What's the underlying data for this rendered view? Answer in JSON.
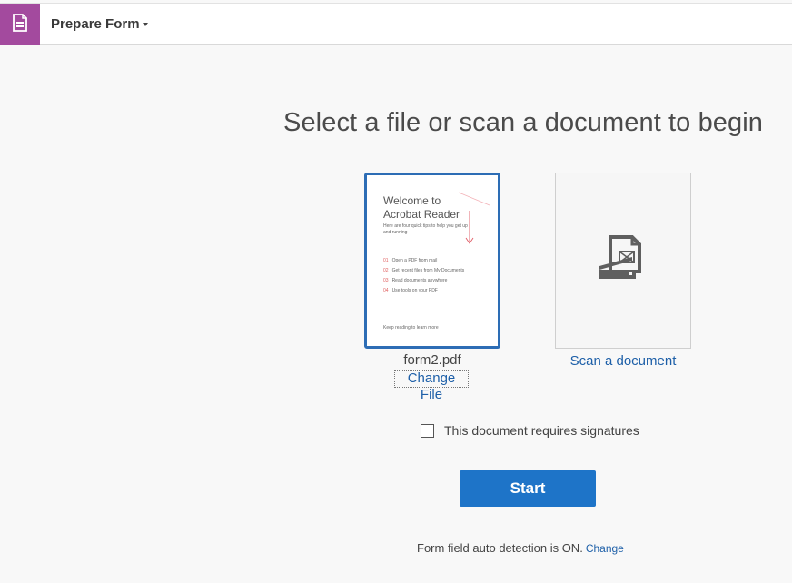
{
  "header": {
    "tool_icon": "form-document-icon",
    "tool_title": "Prepare Form"
  },
  "main": {
    "title": "Select a file or scan a document to begin"
  },
  "file_card": {
    "thumbnail": {
      "title_line1": "Welcome to",
      "title_line2": "Acrobat Reader",
      "subtitle": "Here are four quick tips to help you get up and running",
      "tips": [
        {
          "num": "01",
          "text": "Open a PDF from mail"
        },
        {
          "num": "02",
          "text": "Get recent files from My Documents"
        },
        {
          "num": "03",
          "text": "Read documents anywhere"
        },
        {
          "num": "04",
          "text": "Use tools on your PDF"
        }
      ],
      "footer": "Keep reading to learn more"
    },
    "file_name": "form2.pdf",
    "change_label": "Change File"
  },
  "scan_card": {
    "icon": "scanner-icon",
    "label": "Scan a document"
  },
  "signature_option": {
    "checked": false,
    "label": "This document requires signatures"
  },
  "start_button": {
    "label": "Start"
  },
  "detection": {
    "text": "Form field auto detection is ON.",
    "change_label": "Change"
  },
  "colors": {
    "tool_accent": "#a34a9e",
    "primary_button": "#1e74c8",
    "link": "#1d5fa8",
    "selected_border": "#2d6db5"
  }
}
